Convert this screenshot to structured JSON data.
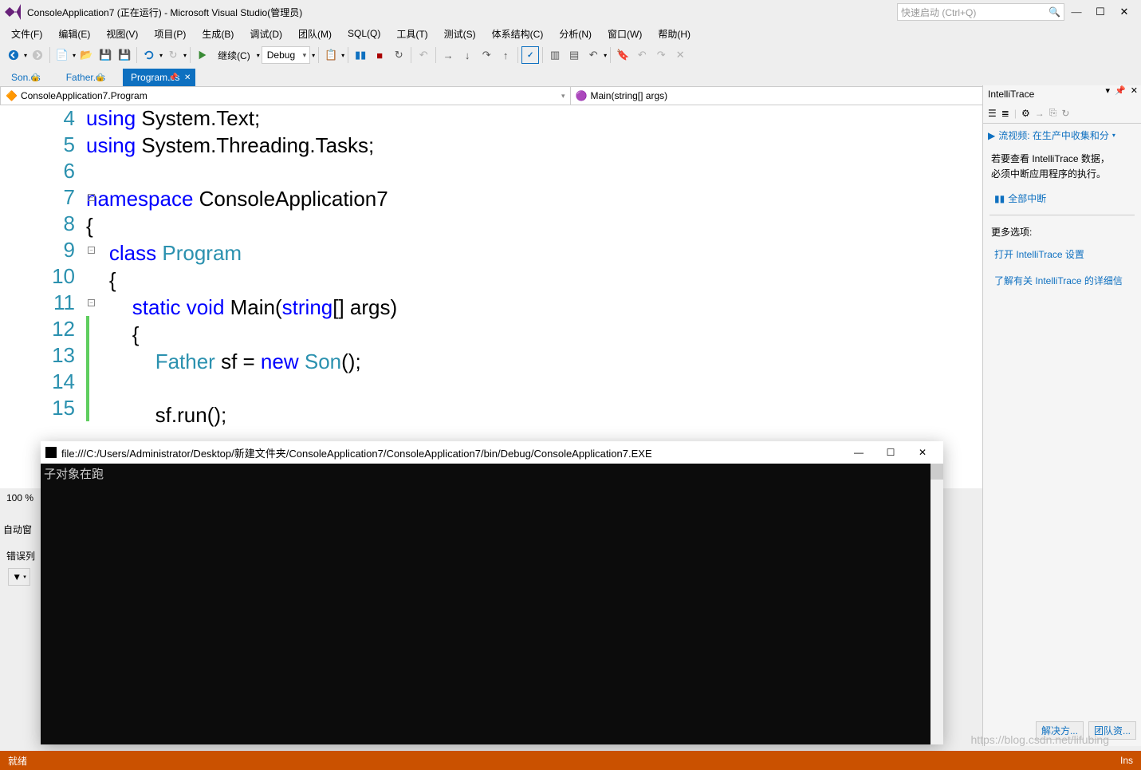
{
  "title": "ConsoleApplication7 (正在运行) - Microsoft Visual Studio(管理员)",
  "quick_launch": "快速启动 (Ctrl+Q)",
  "menu": [
    "文件(F)",
    "编辑(E)",
    "视图(V)",
    "项目(P)",
    "生成(B)",
    "调试(D)",
    "团队(M)",
    "SQL(Q)",
    "工具(T)",
    "测试(S)",
    "体系结构(C)",
    "分析(N)",
    "窗口(W)",
    "帮助(H)"
  ],
  "toolbar": {
    "continue": "继续(C)",
    "config": "Debug"
  },
  "tabs": [
    {
      "name": "Son.cs",
      "active": false,
      "pinned": true
    },
    {
      "name": "Father.cs",
      "active": false,
      "pinned": true
    },
    {
      "name": "Program.cs",
      "active": true,
      "pinned": true
    }
  ],
  "crumb": {
    "left": "ConsoleApplication7.Program",
    "right": "Main(string[] args)"
  },
  "lines": [
    "4",
    "5",
    "6",
    "7",
    "8",
    "9",
    "10",
    "11",
    "12",
    "13",
    "14",
    "15"
  ],
  "code": {
    "l4a": "using",
    "l4b": " System.Text;",
    "l5a": "using",
    "l5b": " System.Threading.Tasks;",
    "l7a": "namespace",
    "l7b": " ConsoleApplication7",
    "l8": "{",
    "l9a": "    ",
    "l9b": "class",
    "l9c": " ",
    "l9d": "Program",
    "l10": "    {",
    "l11a": "        ",
    "l11b": "static",
    "l11c": " ",
    "l11d": "void",
    "l11e": " Main(",
    "l11f": "string",
    "l11g": "[] args)",
    "l12": "        {",
    "l13a": "            ",
    "l13b": "Father",
    "l13c": " sf = ",
    "l13d": "new",
    "l13e": " ",
    "l13f": "Son",
    "l13g": "();",
    "l15": "            sf.run();"
  },
  "zoom": "100 %",
  "tab2": "自动窗",
  "errlist": "错误列",
  "intellitrace": {
    "title": "IntelliTrace",
    "video": "流视频: 在生产中收集和分",
    "msg1": "若要查看 IntelliTrace 数据，",
    "msg2": "必须中断应用程序的执行。",
    "breakall": "全部中断",
    "more": "更多选项:",
    "link1": "打开 IntelliTrace 设置",
    "link2": "了解有关 IntelliTrace 的详细信"
  },
  "bottom_tabs": [
    "解决方...",
    "团队资..."
  ],
  "console": {
    "title": "file:///C:/Users/Administrator/Desktop/新建文件夹/ConsoleApplication7/ConsoleApplication7/bin/Debug/ConsoleApplication7.EXE",
    "output": "子对象在跑"
  },
  "status": {
    "ready": "就绪",
    "ins": "Ins"
  },
  "watermark": "https://blog.csdn.net/lifubing"
}
